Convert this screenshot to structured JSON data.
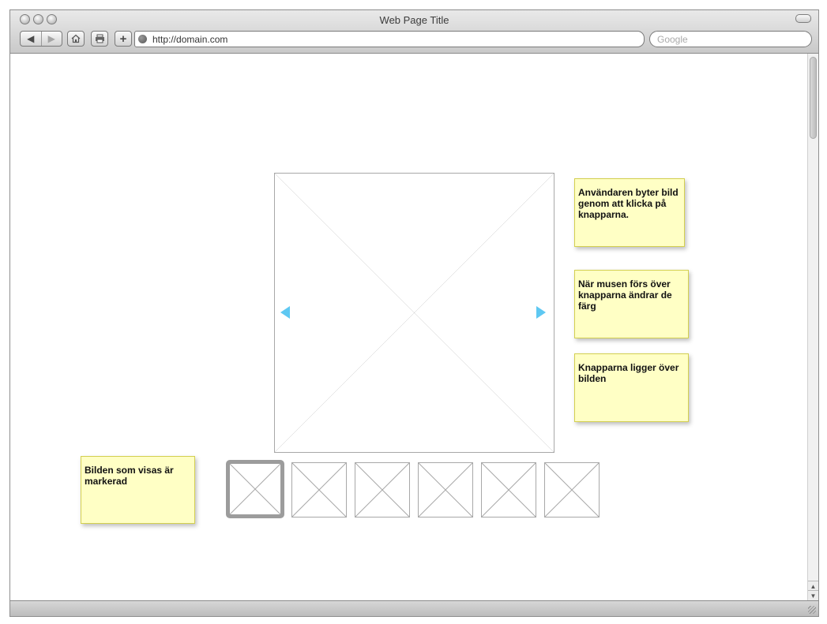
{
  "browser": {
    "title": "Web Page Title",
    "url": "http://domain.com",
    "search_placeholder": "Google",
    "icons": {
      "back": "back-arrow-icon",
      "forward": "forward-arrow-icon",
      "home": "home-icon",
      "print": "print-icon",
      "add": "plus-icon",
      "site": "globe-icon"
    }
  },
  "gallery": {
    "main_image": "image-placeholder",
    "prev_button_icon": "triangle-left-icon",
    "next_button_icon": "triangle-right-icon",
    "arrow_color": "#5ec8f2",
    "thumbnail_count": 6,
    "selected_thumbnail_index": 0
  },
  "notes": {
    "switch_image": "Användaren byter bild genom att klicka på knapparna.",
    "hover_color": "När musen förs över knapparna ändrar de färg",
    "buttons_over_image": "Knapparna ligger över bilden",
    "selected_marked": "Bilden som visas är markerad",
    "note_color": "#ffffc5"
  }
}
